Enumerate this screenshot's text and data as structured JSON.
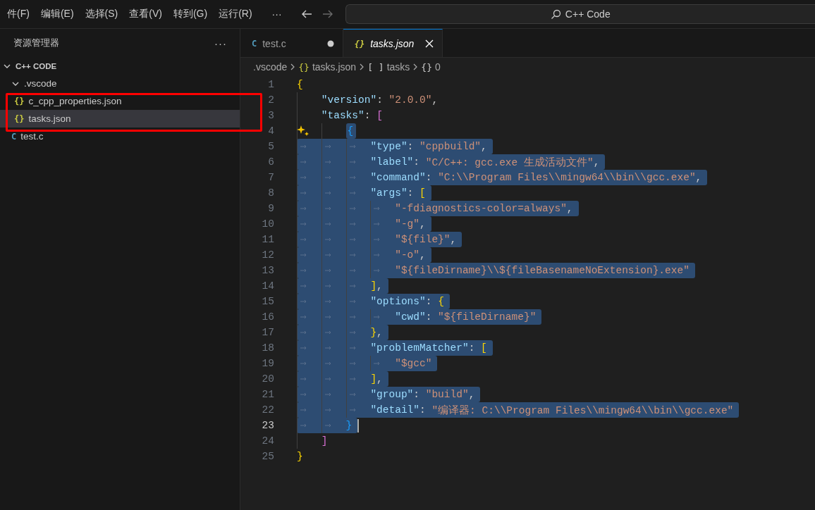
{
  "menu": [
    "件(F)",
    "编辑(E)",
    "选择(S)",
    "查看(V)",
    "转到(G)",
    "运行(R)"
  ],
  "menu_more": "···",
  "nav": {
    "forward_disabled": true
  },
  "command_center": {
    "text": "C++ Code"
  },
  "explorer": {
    "title": "资源管理器",
    "more": "···",
    "root": {
      "label": "C++ CODE",
      "expanded": true,
      "children": [
        {
          "label": ".vscode",
          "kind": "folder",
          "expanded": true,
          "children": [
            {
              "label": "c_cpp_properties.json",
              "kind": "file",
              "icon": "{}",
              "color": "#cbcb41",
              "selected": false
            },
            {
              "label": "tasks.json",
              "kind": "file",
              "icon": "{}",
              "color": "#cbcb41",
              "selected": true
            }
          ]
        },
        {
          "label": "test.c",
          "kind": "file",
          "icon": "C",
          "color": "#519aba",
          "selected": false
        }
      ]
    }
  },
  "annotations": [
    {
      "kind": "frame",
      "color": "#ff0000"
    }
  ],
  "tabs": [
    {
      "label": "test.c",
      "icon": "C",
      "color": "#519aba",
      "selected": false,
      "modified": true,
      "preview": false
    },
    {
      "label": "tasks.json",
      "icon": "{}",
      "color": "#cbcb41",
      "selected": true,
      "modified": false,
      "preview": true
    }
  ],
  "breadcrumb": [
    {
      "text": ".vscode"
    },
    {
      "icon": "{}",
      "text": "tasks.json"
    },
    {
      "icon": "[ ]",
      "text": "tasks"
    },
    {
      "icon": "{}",
      "text": "0"
    }
  ],
  "editor": {
    "lines": [
      {
        "n": "1",
        "selected": false,
        "tokens": [
          {
            "kind": "bracket",
            "text": "{",
            "color": "#ffd700"
          }
        ],
        "children": [
          {
            "n": "2",
            "selected": false,
            "tokens": [
              {
                "kind": "key",
                "text": "\"version\""
              },
              {
                "kind": "punct",
                "text": ": "
              },
              {
                "kind": "str",
                "text": "\"2.0.0\""
              },
              {
                "kind": "punct",
                "text": ","
              }
            ]
          },
          {
            "n": "3",
            "selected": false,
            "tokens": [
              {
                "kind": "key",
                "text": "\"tasks\""
              },
              {
                "kind": "punct",
                "text": ": "
              },
              {
                "kind": "bracket",
                "text": "[",
                "color": "#da70d6"
              }
            ],
            "children": [
              {
                "n": "4",
                "selected": true,
                "indent_selected": false,
                "sparkle": true,
                "tokens": [
                  {
                    "kind": "bracket",
                    "text": "{",
                    "color": "#179fff"
                  }
                ],
                "children": [
                  {
                    "n": "5",
                    "selected": true,
                    "tokens": [
                      {
                        "kind": "key",
                        "text": "\"type\""
                      },
                      {
                        "kind": "punct",
                        "text": ": "
                      },
                      {
                        "kind": "str",
                        "text": "\"cppbuild\""
                      },
                      {
                        "kind": "punct",
                        "text": ","
                      }
                    ]
                  },
                  {
                    "n": "6",
                    "selected": true,
                    "tokens": [
                      {
                        "kind": "key",
                        "text": "\"label\""
                      },
                      {
                        "kind": "punct",
                        "text": ": "
                      },
                      {
                        "kind": "str",
                        "text": "\"C/C++: gcc.exe 生成活动文件\""
                      },
                      {
                        "kind": "punct",
                        "text": ","
                      }
                    ]
                  },
                  {
                    "n": "7",
                    "selected": true,
                    "tokens": [
                      {
                        "kind": "key",
                        "text": "\"command\""
                      },
                      {
                        "kind": "punct",
                        "text": ": "
                      },
                      {
                        "kind": "str",
                        "text": "\"C:\\\\Program Files\\\\mingw64\\\\bin\\\\gcc.exe\""
                      },
                      {
                        "kind": "punct",
                        "text": ","
                      }
                    ]
                  },
                  {
                    "n": "8",
                    "selected": true,
                    "tokens": [
                      {
                        "kind": "key",
                        "text": "\"args\""
                      },
                      {
                        "kind": "punct",
                        "text": ": "
                      },
                      {
                        "kind": "bracket",
                        "text": "[",
                        "color": "#ffd700"
                      }
                    ],
                    "children": [
                      {
                        "n": "9",
                        "selected": true,
                        "tokens": [
                          {
                            "kind": "str",
                            "text": "\"-fdiagnostics-color=always\""
                          },
                          {
                            "kind": "punct",
                            "text": ","
                          }
                        ]
                      },
                      {
                        "n": "10",
                        "selected": true,
                        "tokens": [
                          {
                            "kind": "str",
                            "text": "\"-g\""
                          },
                          {
                            "kind": "punct",
                            "text": ","
                          }
                        ]
                      },
                      {
                        "n": "11",
                        "selected": true,
                        "tokens": [
                          {
                            "kind": "str",
                            "text": "\"${file}\""
                          },
                          {
                            "kind": "punct",
                            "text": ","
                          }
                        ]
                      },
                      {
                        "n": "12",
                        "selected": true,
                        "tokens": [
                          {
                            "kind": "str",
                            "text": "\"-o\""
                          },
                          {
                            "kind": "punct",
                            "text": ","
                          }
                        ]
                      },
                      {
                        "n": "13",
                        "selected": true,
                        "tokens": [
                          {
                            "kind": "str",
                            "text": "\"${fileDirname}\\\\${fileBasenameNoExtension}.exe\""
                          }
                        ]
                      }
                    ]
                  },
                  {
                    "n": "14",
                    "selected": true,
                    "tokens": [
                      {
                        "kind": "bracket",
                        "text": "]",
                        "color": "#ffd700"
                      },
                      {
                        "kind": "punct",
                        "text": ","
                      }
                    ]
                  },
                  {
                    "n": "15",
                    "selected": true,
                    "tokens": [
                      {
                        "kind": "key",
                        "text": "\"options\""
                      },
                      {
                        "kind": "punct",
                        "text": ": "
                      },
                      {
                        "kind": "bracket",
                        "text": "{",
                        "color": "#ffd700"
                      }
                    ],
                    "children": [
                      {
                        "n": "16",
                        "selected": true,
                        "tokens": [
                          {
                            "kind": "key",
                            "text": "\"cwd\""
                          },
                          {
                            "kind": "punct",
                            "text": ": "
                          },
                          {
                            "kind": "str",
                            "text": "\"${fileDirname}\""
                          }
                        ]
                      }
                    ]
                  },
                  {
                    "n": "17",
                    "selected": true,
                    "tokens": [
                      {
                        "kind": "bracket",
                        "text": "}",
                        "color": "#ffd700"
                      },
                      {
                        "kind": "punct",
                        "text": ","
                      }
                    ]
                  },
                  {
                    "n": "18",
                    "selected": true,
                    "tokens": [
                      {
                        "kind": "key",
                        "text": "\"problemMatcher\""
                      },
                      {
                        "kind": "punct",
                        "text": ": "
                      },
                      {
                        "kind": "bracket",
                        "text": "[",
                        "color": "#ffd700"
                      }
                    ],
                    "children": [
                      {
                        "n": "19",
                        "selected": true,
                        "tokens": [
                          {
                            "kind": "str",
                            "text": "\"$gcc\""
                          }
                        ]
                      }
                    ]
                  },
                  {
                    "n": "20",
                    "selected": true,
                    "tokens": [
                      {
                        "kind": "bracket",
                        "text": "]",
                        "color": "#ffd700"
                      },
                      {
                        "kind": "punct",
                        "text": ","
                      }
                    ]
                  },
                  {
                    "n": "21",
                    "selected": true,
                    "tokens": [
                      {
                        "kind": "key",
                        "text": "\"group\""
                      },
                      {
                        "kind": "punct",
                        "text": ": "
                      },
                      {
                        "kind": "str",
                        "text": "\"build\""
                      },
                      {
                        "kind": "punct",
                        "text": ","
                      }
                    ]
                  },
                  {
                    "n": "22",
                    "selected": true,
                    "tokens": [
                      {
                        "kind": "key",
                        "text": "\"detail\""
                      },
                      {
                        "kind": "punct",
                        "text": ": "
                      },
                      {
                        "kind": "str",
                        "text": "\"编译器: C:\\\\Program Files\\\\mingw64\\\\bin\\\\gcc.exe\""
                      }
                    ]
                  }
                ]
              },
              {
                "n": "23",
                "selected": true,
                "current": true,
                "cursor": true,
                "tokens": [
                  {
                    "kind": "bracket",
                    "text": "}",
                    "color": "#179fff"
                  }
                ]
              }
            ]
          },
          {
            "n": "24",
            "selected": false,
            "tokens": [
              {
                "kind": "bracket",
                "text": "]",
                "color": "#da70d6"
              }
            ]
          }
        ]
      },
      {
        "n": "25",
        "selected": false,
        "tokens": [
          {
            "kind": "bracket",
            "text": "}",
            "color": "#ffd700"
          }
        ]
      }
    ]
  }
}
